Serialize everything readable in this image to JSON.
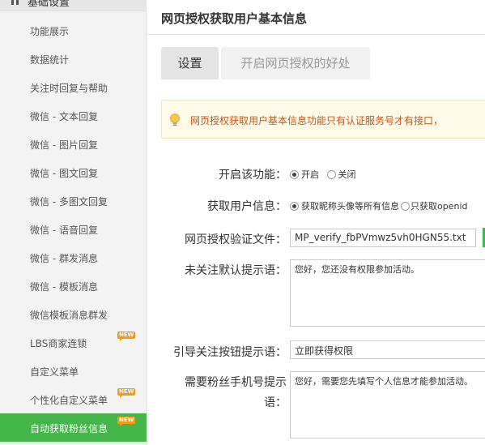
{
  "sidebar": {
    "section_title": "基础设置",
    "items": [
      {
        "label": "功能展示"
      },
      {
        "label": "数据统计"
      },
      {
        "label": "关注时回复与帮助"
      },
      {
        "label": "微信 - 文本回复"
      },
      {
        "label": "微信 - 图片回复"
      },
      {
        "label": "微信 - 图文回复"
      },
      {
        "label": "微信 - 多图文回复"
      },
      {
        "label": "微信 - 语音回复"
      },
      {
        "label": "微信 - 群发消息"
      },
      {
        "label": "微信 - 模板消息"
      },
      {
        "label": "微信模板消息群发"
      },
      {
        "label": "LBS商家连锁",
        "badge": "NEW"
      },
      {
        "label": "自定义菜单"
      },
      {
        "label": "个性化自定义菜单",
        "badge": "NEW"
      },
      {
        "label": "自动获取粉丝信息",
        "badge": "NEW",
        "active": true
      }
    ],
    "active_color": "#44b549"
  },
  "main": {
    "title": "网页授权获取用户基本信息",
    "tabs": [
      {
        "label": "设置"
      },
      {
        "label": "开启网页授权的好处"
      }
    ],
    "notice": "网页授权获取用户基本信息功能只有认证服务号才有接口，",
    "form": {
      "enable": {
        "label": "开启该功能：",
        "options": [
          "开启",
          "关闭"
        ],
        "selected": "开启"
      },
      "user_info": {
        "label": "获取用户信息：",
        "options": [
          "获取昵称头像等所有信息",
          "只获取openid"
        ],
        "selected": "获取昵称头像等所有信息"
      },
      "verify_file": {
        "label": "网页授权验证文件：",
        "value": "MP_verify_fbPVmwz5vh0HGN55.txt"
      },
      "unfollow_tip": {
        "label": "未关注默认提示语：",
        "value": "您好，您还没有权限参加活动。"
      },
      "follow_button_tip": {
        "label": "引导关注按钮提示语：",
        "value": "立即获得权限"
      },
      "phone_tip": {
        "label_line1": "需要粉丝手机号提示",
        "label_line2": "语：",
        "value": "您好，需要您先填写个人信息才能参加活动。"
      }
    }
  }
}
